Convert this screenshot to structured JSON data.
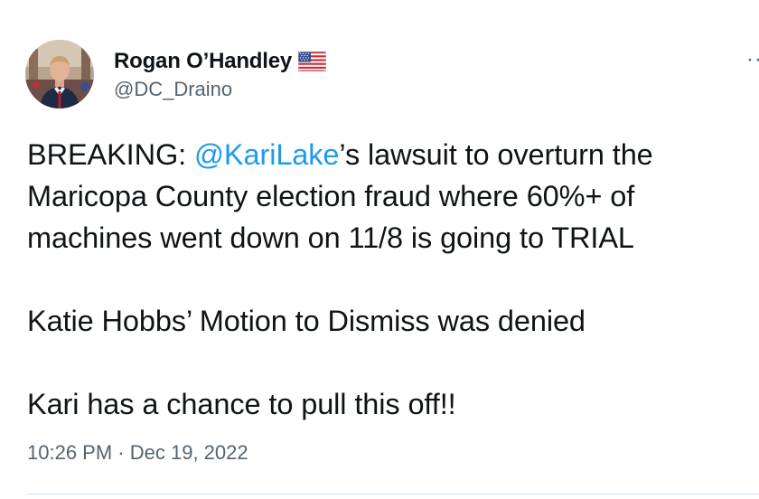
{
  "author": {
    "display_name": "Rogan O’Handley",
    "handle": "@DC_Draino",
    "badge_icon": "us-flag-icon"
  },
  "more_menu": {
    "label": "··",
    "icon": "more-icon"
  },
  "tweet": {
    "line1_prefix": "BREAKING: ",
    "mention": "@KariLake",
    "line1_suffix": "’s lawsuit to overturn the",
    "line2": "Maricopa County election fraud where 60%+ of",
    "line3": "machines went down on 11/8 is going to TRIAL",
    "line4": "Katie Hobbs’ Motion to Dismiss was denied",
    "line5": "Kari has a chance to pull this off!!"
  },
  "meta": {
    "time": "10:26 PM",
    "separator": " · ",
    "date": "Dec 19, 2022"
  },
  "colors": {
    "link": "#1d9bf0",
    "secondary": "#536471",
    "text": "#0f1419"
  }
}
